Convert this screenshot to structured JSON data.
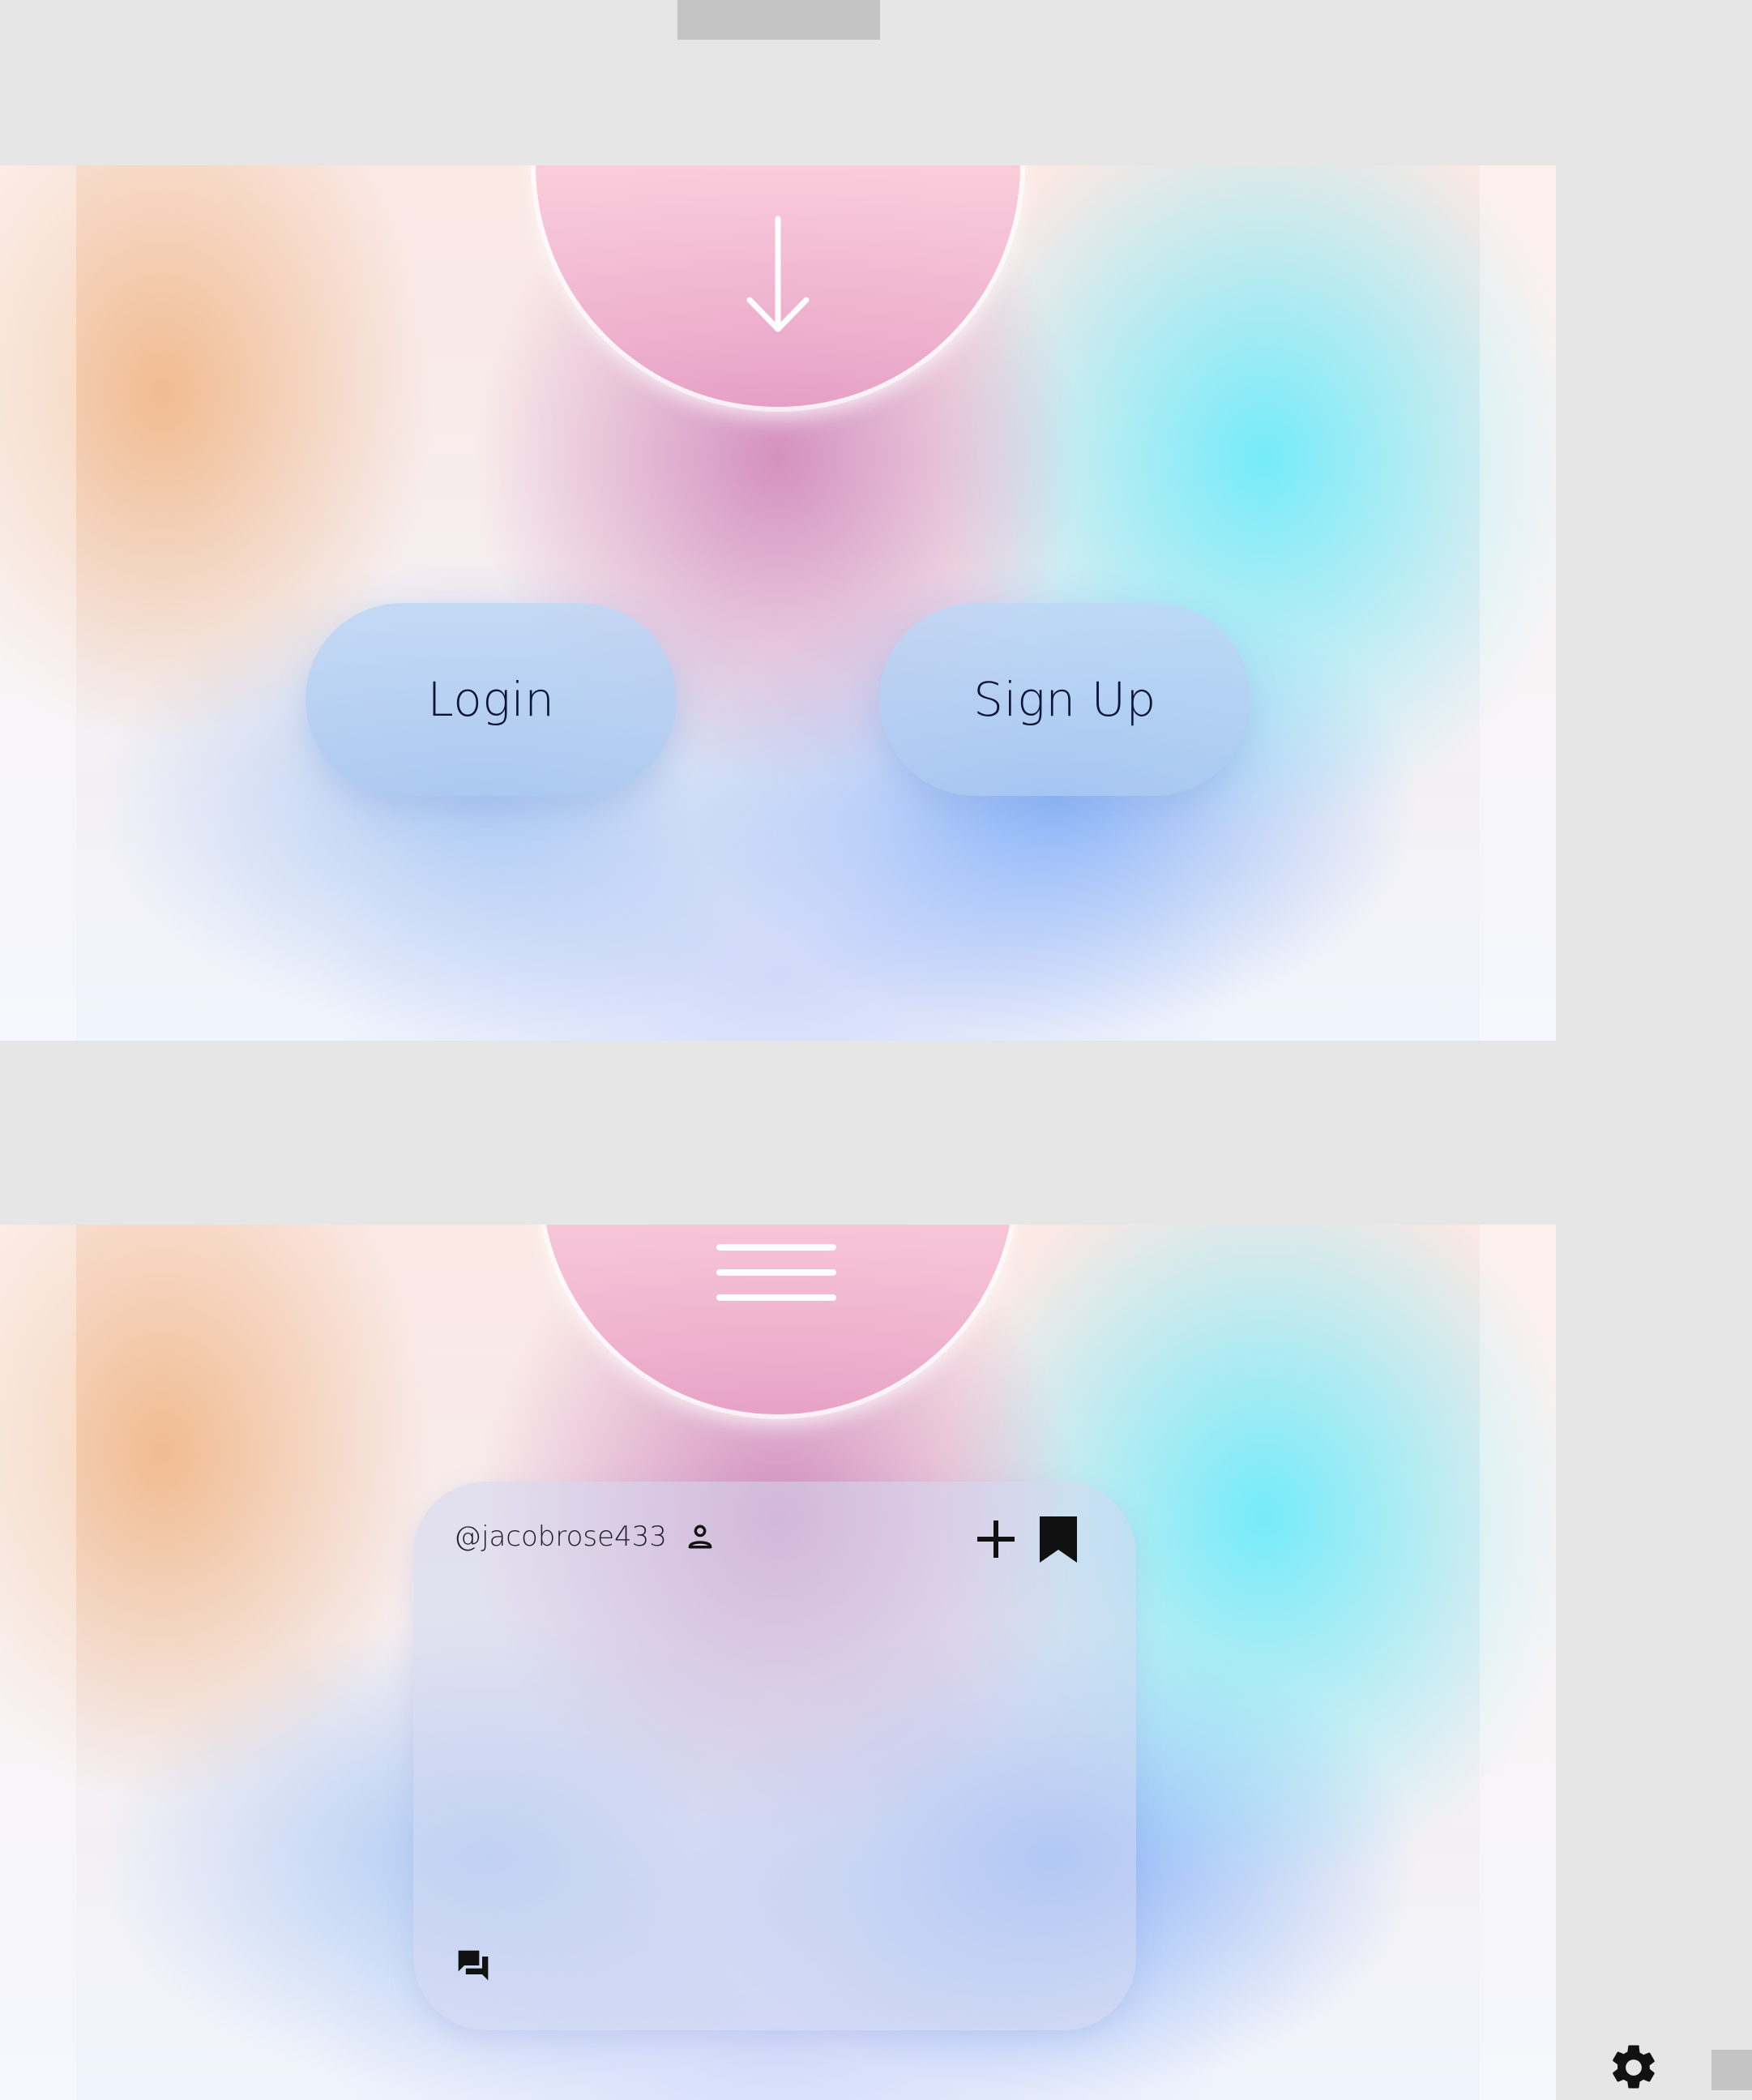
{
  "colors": {
    "canvas": "#e6e6e6",
    "tab": "#c4c4c4",
    "button_text": "#0c1436",
    "icon": "#111111"
  },
  "landing": {
    "top_icon": "arrow-down-icon",
    "login_label": "Login",
    "signup_label": "Sign Up"
  },
  "feed": {
    "top_icon": "hamburger-menu-icon",
    "card": {
      "username": "@jacobrose433",
      "user_icon": "person-icon",
      "actions": [
        "add-icon",
        "bookmark-icon"
      ],
      "bottom_icon": "chat-bubbles-icon"
    }
  },
  "corner": {
    "icon": "gear-icon"
  }
}
